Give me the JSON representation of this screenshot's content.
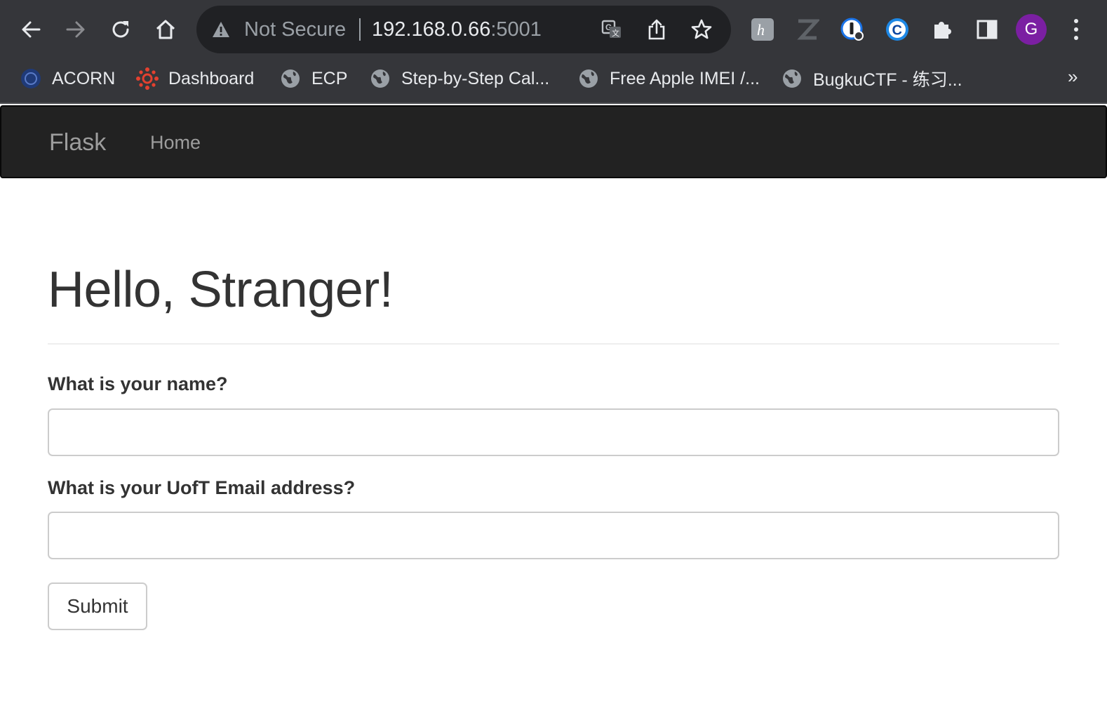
{
  "browser": {
    "omnibox": {
      "security_text": "Not Secure",
      "host": "192.168.0.66",
      "port": ":5001"
    },
    "icons": [
      "back-icon",
      "forward-icon",
      "reload-icon",
      "home-icon",
      "warning-icon",
      "translate-icon",
      "share-icon",
      "bookmark-star-icon",
      "extensions-icon",
      "side-panel-icon",
      "menu-icon"
    ],
    "profile_initial": "G",
    "bookmarks": [
      {
        "label": "ACORN"
      },
      {
        "label": "Dashboard"
      },
      {
        "label": "ECP"
      },
      {
        "label": "Step-by-Step Cal..."
      },
      {
        "label": "Free Apple IMEI /..."
      },
      {
        "label": "BugkuCTF - 练习..."
      }
    ],
    "more_bookmarks": "»"
  },
  "navbar": {
    "brand": "Flask",
    "home": "Home"
  },
  "page": {
    "title": "Hello, Stranger!",
    "form": {
      "name_label": "What is your name?",
      "name_value": "",
      "email_label": "What is your UofT Email address?",
      "email_value": "",
      "submit_label": "Submit"
    }
  },
  "colors": {
    "chrome_bg": "#35363a",
    "omnibox_bg": "#202124",
    "navbar_bg": "#222222",
    "navbar_text": "#9d9d9d",
    "text": "#333333",
    "avatar": "#7b1fa2"
  }
}
